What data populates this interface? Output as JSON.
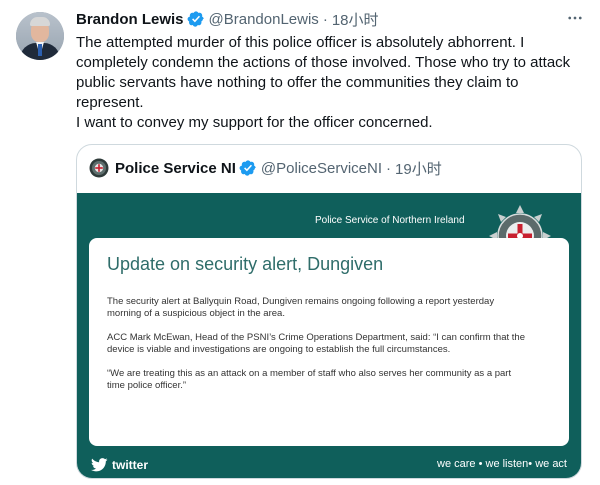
{
  "author": {
    "name": "Brandon Lewis",
    "handle": "@BrandonLewis",
    "time": "18小时",
    "separator": "·",
    "verified": true,
    "avatar_icon": "profile-photo"
  },
  "tweet": {
    "paragraphs": [
      "The attempted murder of this police officer is absolutely abhorrent. I completely condemn the actions of those involved. Those who try to attack public servants have nothing to offer the communities they claim to represent.",
      "I want to convey my support for the officer concerned."
    ]
  },
  "more_icon": "ellipsis-icon",
  "quoted": {
    "name": "Police Service NI",
    "handle": "@PoliceServiceNI",
    "time": "19小时",
    "separator": "·",
    "verified": true,
    "card": {
      "organisation": "Police Service of Northern Ireland",
      "title": "Update on security alert, Dungiven",
      "paragraphs": [
        "The security alert at Ballyquin Road, Dungiven remains ongoing following a report yesterday morning of a suspicious object in the area.",
        "ACC Mark McEwan, Head of the PSNI’s Crime Operations Department, said: “I can confirm that the device is viable and investigations are ongoing to establish the full circumstances.",
        "“We are treating this as an attack on a member of staff who also serves her community as a part time police officer.”"
      ],
      "footer_brand": "twitter",
      "slogan": "we care • we listen• we act"
    }
  },
  "colors": {
    "verified": "#1d9bf0",
    "card_bg": "#0f5f5b",
    "title_teal": "#2f6d6a",
    "muted": "#536471"
  }
}
